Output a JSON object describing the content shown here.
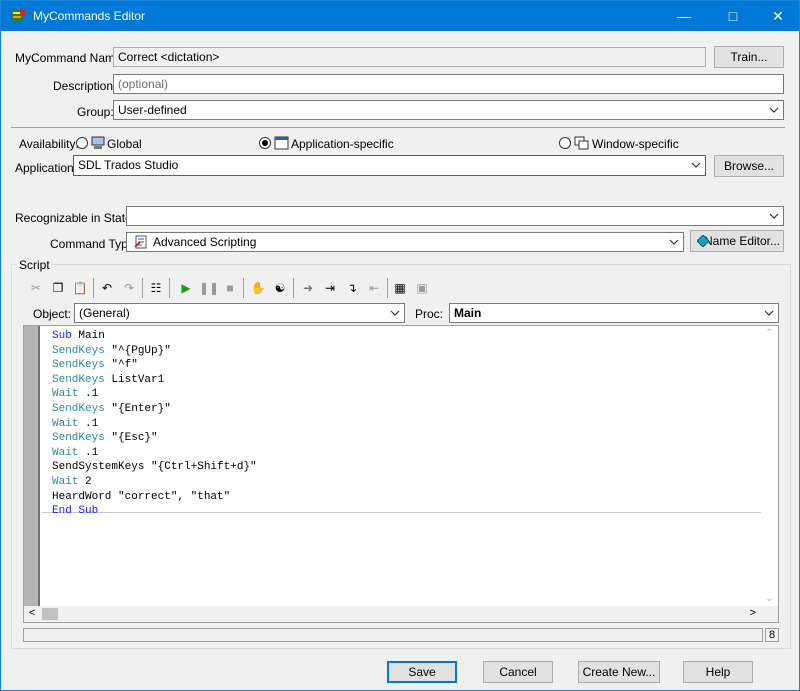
{
  "window": {
    "title": "MyCommands Editor",
    "icon": "mycommands-app-icon",
    "controls": [
      "minimize-icon",
      "maximize-icon",
      "close-icon"
    ]
  },
  "form": {
    "name_label": "MyCommand Name:",
    "name_value": "Correct <dictation>",
    "train_label": "Train...",
    "description_label": "Description:",
    "description_placeholder": "(optional)",
    "group_label": "Group:",
    "group_value": "User-defined",
    "availability_label": "Availability:",
    "availability_options": [
      "Global",
      "Application-specific",
      "Window-specific"
    ],
    "availability_selected": "Application-specific",
    "application_label": "Application:",
    "application_value": "SDL Trados Studio",
    "browse_label": "Browse...",
    "states_label": "Recognizable in States:",
    "states_value": "",
    "command_type_label": "Command Type:",
    "command_type_value": "Advanced Scripting",
    "name_editor_label": "Name Editor..."
  },
  "script": {
    "group_label": "Script",
    "object_label": "Object:",
    "object_value": "(General)",
    "proc_label": "Proc:",
    "proc_value": "Main",
    "lines": [
      "Sub Main",
      "SendKeys \"^{PgUp}\"",
      "SendKeys \"^f\"",
      "SendKeys ListVar1",
      "Wait .1",
      "SendKeys \"{Enter}\"",
      "Wait .1",
      "SendKeys \"{Esc}\"",
      "Wait .1",
      "SendSystemKeys \"{Ctrl+Shift+d}\"",
      "Wait 2",
      "HeardWord \"correct\", \"that\"",
      "End Sub"
    ],
    "status_line": "8"
  },
  "buttons": {
    "save": "Save",
    "cancel": "Cancel",
    "create_new": "Create New...",
    "help": "Help"
  },
  "colors": {
    "titlebar": "#0078d7",
    "keyword": "#1a1aff",
    "function": "#2c8aa0"
  }
}
